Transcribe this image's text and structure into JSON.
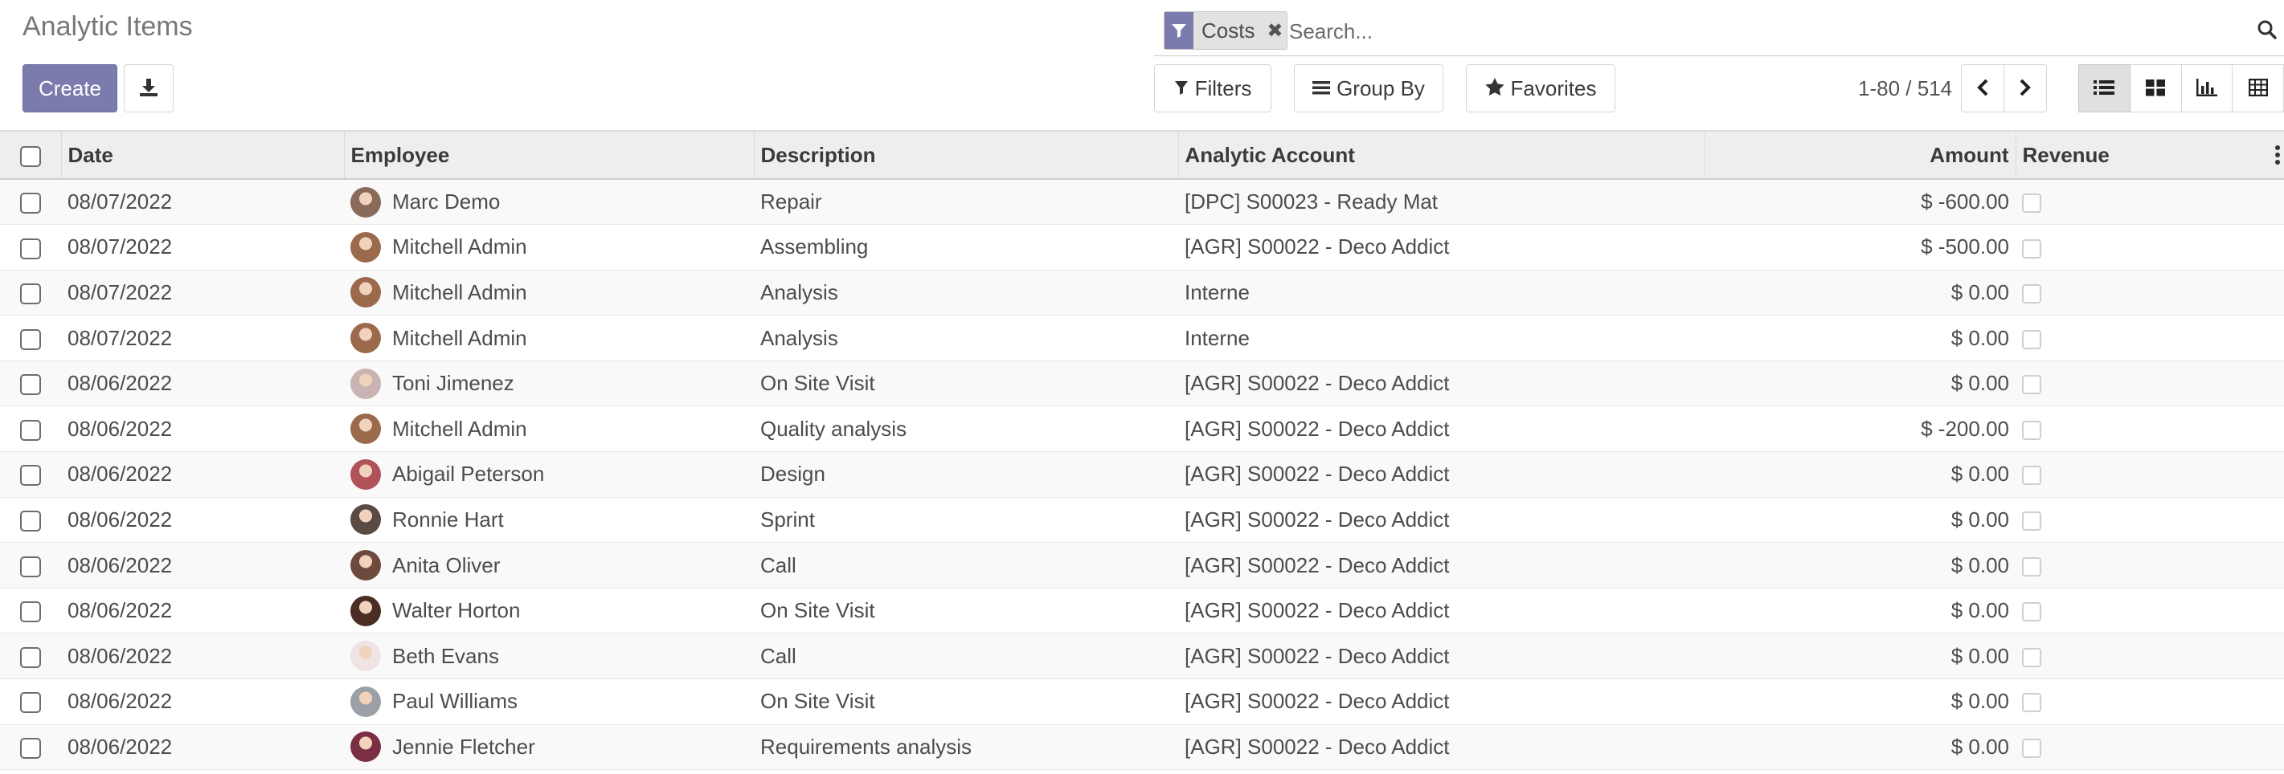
{
  "page": {
    "title": "Analytic Items"
  },
  "toolbar": {
    "create_label": "Create",
    "download_icon": "download-icon"
  },
  "search": {
    "facet_label": "Costs",
    "facet_icon": "filter-icon",
    "remove_symbol": "✖",
    "placeholder": "Search..."
  },
  "filters": {
    "filters_label": "Filters",
    "groupby_label": "Group By",
    "favorites_label": "Favorites"
  },
  "pager": {
    "value": "1-80 / 514"
  },
  "views": [
    "list-view-icon",
    "kanban-view-icon",
    "graph-view-icon",
    "pivot-view-icon"
  ],
  "accent_color": "#7c7bad",
  "table": {
    "columns": [
      "Date",
      "Employee",
      "Description",
      "Analytic Account",
      "Amount",
      "Revenue"
    ],
    "rows": [
      {
        "date": "08/07/2022",
        "employee": "Marc Demo",
        "avatar": "#8a6b5a",
        "description": "Repair",
        "account": "[DPC] S00023 - Ready Mat",
        "amount": "$ -600.00"
      },
      {
        "date": "08/07/2022",
        "employee": "Mitchell Admin",
        "avatar": "#9b6a4c",
        "description": "Assembling",
        "account": "[AGR] S00022 - Deco Addict",
        "amount": "$ -500.00"
      },
      {
        "date": "08/07/2022",
        "employee": "Mitchell Admin",
        "avatar": "#9b6a4c",
        "description": "Analysis",
        "account": "Interne",
        "amount": "$ 0.00"
      },
      {
        "date": "08/07/2022",
        "employee": "Mitchell Admin",
        "avatar": "#9b6a4c",
        "description": "Analysis",
        "account": "Interne",
        "amount": "$ 0.00"
      },
      {
        "date": "08/06/2022",
        "employee": "Toni Jimenez",
        "avatar": "#c9b3b3",
        "description": "On Site Visit",
        "account": "[AGR] S00022 - Deco Addict",
        "amount": "$ 0.00"
      },
      {
        "date": "08/06/2022",
        "employee": "Mitchell Admin",
        "avatar": "#9b6a4c",
        "description": "Quality analysis",
        "account": "[AGR] S00022 - Deco Addict",
        "amount": "$ -200.00"
      },
      {
        "date": "08/06/2022",
        "employee": "Abigail Peterson",
        "avatar": "#b0525a",
        "description": "Design",
        "account": "[AGR] S00022 - Deco Addict",
        "amount": "$ 0.00"
      },
      {
        "date": "08/06/2022",
        "employee": "Ronnie Hart",
        "avatar": "#5a4a44",
        "description": "Sprint",
        "account": "[AGR] S00022 - Deco Addict",
        "amount": "$ 0.00"
      },
      {
        "date": "08/06/2022",
        "employee": "Anita Oliver",
        "avatar": "#6e4a3e",
        "description": "Call",
        "account": "[AGR] S00022 - Deco Addict",
        "amount": "$ 0.00"
      },
      {
        "date": "08/06/2022",
        "employee": "Walter Horton",
        "avatar": "#4a2e24",
        "description": "On Site Visit",
        "account": "[AGR] S00022 - Deco Addict",
        "amount": "$ 0.00"
      },
      {
        "date": "08/06/2022",
        "employee": "Beth Evans",
        "avatar": "#efe3e3",
        "description": "Call",
        "account": "[AGR] S00022 - Deco Addict",
        "amount": "$ 0.00"
      },
      {
        "date": "08/06/2022",
        "employee": "Paul Williams",
        "avatar": "#9aa0a6",
        "description": "On Site Visit",
        "account": "[AGR] S00022 - Deco Addict",
        "amount": "$ 0.00"
      },
      {
        "date": "08/06/2022",
        "employee": "Jennie Fletcher",
        "avatar": "#7a2f45",
        "description": "Requirements analysis",
        "account": "[AGR] S00022 - Deco Addict",
        "amount": "$ 0.00"
      }
    ]
  }
}
